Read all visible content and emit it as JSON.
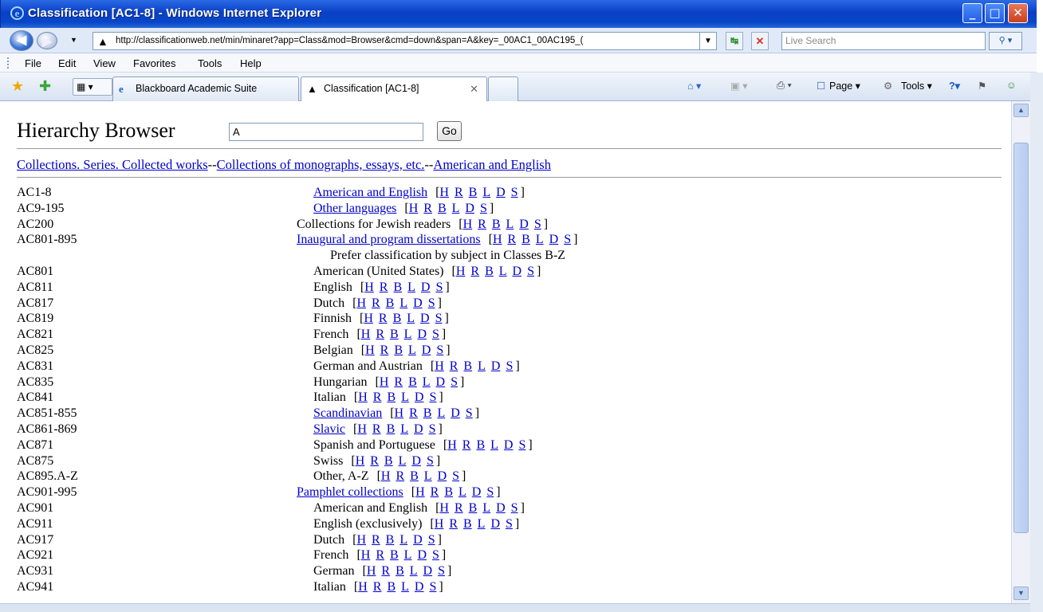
{
  "window": {
    "title": "Classification [AC1-8] - Windows Internet Explorer",
    "minimize": "_",
    "maximize": "□",
    "close": "✕"
  },
  "address_bar": {
    "url": "http://classificationweb.net/min/minaret?app=Class&mod=Browser&cmd=down&span=A&key=_00AC1_00AC195_(",
    "search_placeholder": "Live Search"
  },
  "menu": [
    "File",
    "Edit",
    "View",
    "Favorites",
    "Tools",
    "Help"
  ],
  "tabs": [
    {
      "label": "Blackboard Academic Suite",
      "icon": "ie-page-icon"
    },
    {
      "label": "Classification [AC1-8]",
      "icon": "triangle-icon"
    }
  ],
  "command_bar": {
    "page": "Page",
    "tools": "Tools"
  },
  "page": {
    "title": "Hierarchy Browser",
    "input_value": "A",
    "go_label": "Go",
    "breadcrumb": [
      "Collections. Series. Collected works",
      "Collections of monographs, essays, etc.",
      "American and English"
    ],
    "breadcrumb_sep": "--",
    "link_codes": [
      "H",
      "R",
      "B",
      "L",
      "D",
      "S"
    ],
    "rows": [
      {
        "code": "AC1-8",
        "text": "American and English",
        "link": true,
        "indent": 1
      },
      {
        "code": "AC9-195",
        "text": "Other languages",
        "link": true,
        "indent": 1
      },
      {
        "code": "AC200",
        "text": "Collections for Jewish readers",
        "link": false,
        "indent": 0
      },
      {
        "code": "AC801-895",
        "text": "Inaugural and program dissertations",
        "link": true,
        "indent": 0
      },
      {
        "code": "",
        "text": "Prefer classification by subject in Classes B-Z",
        "link": false,
        "indent": 2,
        "note": true
      },
      {
        "code": "AC801",
        "text": "American (United States)",
        "link": false,
        "indent": 1
      },
      {
        "code": "AC811",
        "text": "English",
        "link": false,
        "indent": 1
      },
      {
        "code": "AC817",
        "text": "Dutch",
        "link": false,
        "indent": 1
      },
      {
        "code": "AC819",
        "text": "Finnish",
        "link": false,
        "indent": 1
      },
      {
        "code": "AC821",
        "text": "French",
        "link": false,
        "indent": 1
      },
      {
        "code": "AC825",
        "text": "Belgian",
        "link": false,
        "indent": 1
      },
      {
        "code": "AC831",
        "text": "German and Austrian",
        "link": false,
        "indent": 1
      },
      {
        "code": "AC835",
        "text": "Hungarian",
        "link": false,
        "indent": 1
      },
      {
        "code": "AC841",
        "text": "Italian",
        "link": false,
        "indent": 1
      },
      {
        "code": "AC851-855",
        "text": "Scandinavian",
        "link": true,
        "indent": 1
      },
      {
        "code": "AC861-869",
        "text": "Slavic",
        "link": true,
        "indent": 1
      },
      {
        "code": "AC871",
        "text": "Spanish and Portuguese",
        "link": false,
        "indent": 1
      },
      {
        "code": "AC875",
        "text": "Swiss",
        "link": false,
        "indent": 1
      },
      {
        "code": "AC895.A-Z",
        "text": "Other, A-Z",
        "link": false,
        "indent": 1
      },
      {
        "code": "AC901-995",
        "text": "Pamphlet collections",
        "link": true,
        "indent": 0
      },
      {
        "code": "AC901",
        "text": "American and English",
        "link": false,
        "indent": 1
      },
      {
        "code": "AC911",
        "text": "English (exclusively)",
        "link": false,
        "indent": 1
      },
      {
        "code": "AC917",
        "text": "Dutch",
        "link": false,
        "indent": 1
      },
      {
        "code": "AC921",
        "text": "French",
        "link": false,
        "indent": 1
      },
      {
        "code": "AC931",
        "text": "German",
        "link": false,
        "indent": 1
      },
      {
        "code": "AC941",
        "text": "Italian",
        "link": false,
        "indent": 1
      }
    ]
  }
}
